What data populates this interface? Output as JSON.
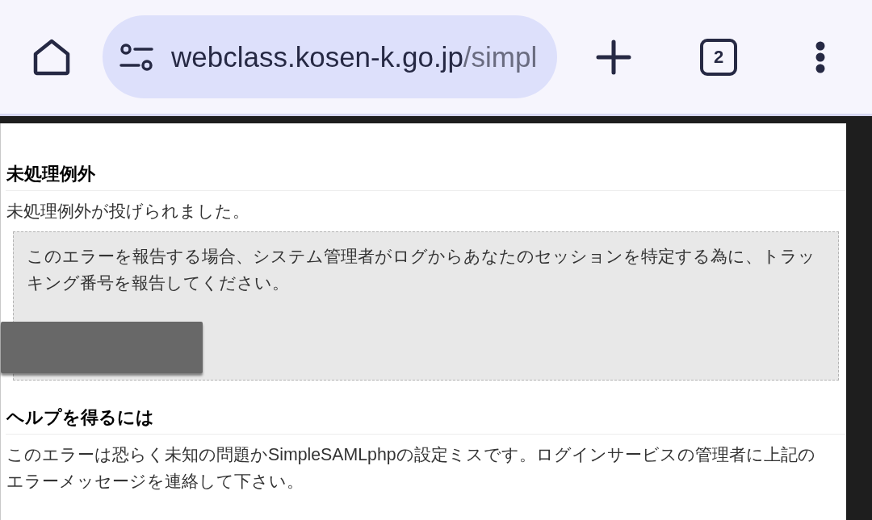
{
  "browser_toolbar": {
    "url_host": "webclass.kosen-k.go.jp",
    "url_path": "/simpl",
    "tab_count": "2"
  },
  "page": {
    "sections": [
      {
        "heading": "未処理例外",
        "text": "未処理例外が投げられました。",
        "notice": {
          "text": "このエラーを報告する場合、システム管理者がログからあなたのセッションを特定する為に、トラッキング番号を報告してください。",
          "redacted": true
        }
      },
      {
        "heading": "ヘルプを得るには",
        "text": "このエラーは恐らく未知の問題かSimpleSAMLphpの設定ミスです。ログインサービスの管理者に上記のエラーメッセージを連絡して下さい。"
      }
    ]
  }
}
